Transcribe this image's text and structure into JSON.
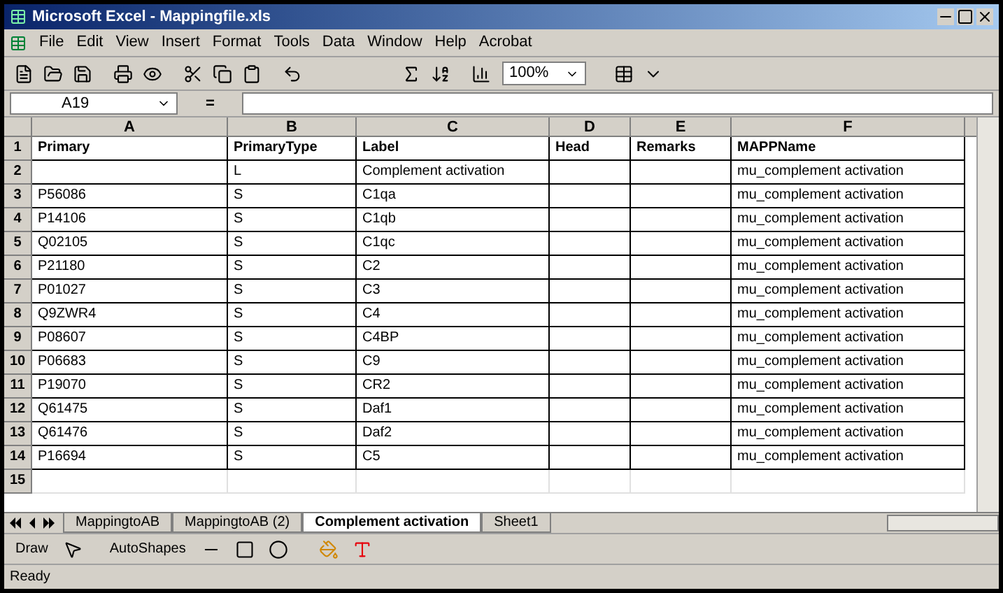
{
  "window": {
    "title": "Microsoft Excel - Mappingfile.xls"
  },
  "menu": [
    "File",
    "Edit",
    "View",
    "Insert",
    "Format",
    "Tools",
    "Data",
    "Window",
    "Help",
    "Acrobat"
  ],
  "toolbar": {
    "zoom": "100%"
  },
  "formula_bar": {
    "name_box": "A19",
    "equals": "="
  },
  "columns": [
    "A",
    "B",
    "C",
    "D",
    "E",
    "F"
  ],
  "rows": [
    {
      "number": "1",
      "kind": "header",
      "cells": {
        "A": "Primary",
        "B": "PrimaryType",
        "C": "Label",
        "D": "Head",
        "E": "Remarks",
        "F": "MAPPName"
      }
    },
    {
      "number": "2",
      "kind": "data",
      "cells": {
        "B": "L",
        "C": "Complement activation",
        "F": "mu_complement activation"
      }
    },
    {
      "number": "3",
      "kind": "data",
      "cells": {
        "A": "P56086",
        "B": "S",
        "C": "C1qa",
        "F": "mu_complement activation"
      }
    },
    {
      "number": "4",
      "kind": "data",
      "cells": {
        "A": "P14106",
        "B": "S",
        "C": "C1qb",
        "F": "mu_complement activation"
      }
    },
    {
      "number": "5",
      "kind": "data",
      "cells": {
        "A": "Q02105",
        "B": "S",
        "C": "C1qc",
        "F": "mu_complement activation"
      }
    },
    {
      "number": "6",
      "kind": "data",
      "cells": {
        "A": "P21180",
        "B": "S",
        "C": "C2",
        "F": "mu_complement activation"
      }
    },
    {
      "number": "7",
      "kind": "data",
      "cells": {
        "A": "P01027",
        "B": "S",
        "C": "C3",
        "F": "mu_complement activation"
      }
    },
    {
      "number": "8",
      "kind": "data",
      "cells": {
        "A": "Q9ZWR4",
        "B": "S",
        "C": "C4",
        "F": "mu_complement activation"
      }
    },
    {
      "number": "9",
      "kind": "data",
      "cells": {
        "A": "P08607",
        "B": "S",
        "C": "C4BP",
        "F": "mu_complement activation"
      }
    },
    {
      "number": "10",
      "kind": "data",
      "cells": {
        "A": "P06683",
        "B": "S",
        "C": "C9",
        "F": "mu_complement activation"
      }
    },
    {
      "number": "11",
      "kind": "data",
      "cells": {
        "A": "P19070",
        "B": "S",
        "C": "CR2",
        "F": "mu_complement activation"
      }
    },
    {
      "number": "12",
      "kind": "data",
      "cells": {
        "A": "Q61475",
        "B": "S",
        "C": "Daf1",
        "F": "mu_complement activation"
      }
    },
    {
      "number": "13",
      "kind": "data",
      "cells": {
        "A": "Q61476",
        "B": "S",
        "C": "Daf2",
        "F": "mu_complement activation"
      }
    },
    {
      "number": "14",
      "kind": "data",
      "cells": {
        "A": "P16694",
        "B": "S",
        "C": "C5",
        "F": "mu_complement activation"
      }
    },
    {
      "number": "15",
      "kind": "empty",
      "cells": {}
    }
  ],
  "sheet_tabs": [
    {
      "label": "MappingtoAB",
      "selected": false
    },
    {
      "label": "MappingtoAB (2)",
      "selected": false
    },
    {
      "label": "Complement activation",
      "selected": true
    },
    {
      "label": "Sheet1",
      "selected": false
    }
  ],
  "drawing_toolbar": {
    "draw": "Draw",
    "autoshapes": "AutoShapes"
  },
  "status_bar": {
    "text": "Ready"
  }
}
